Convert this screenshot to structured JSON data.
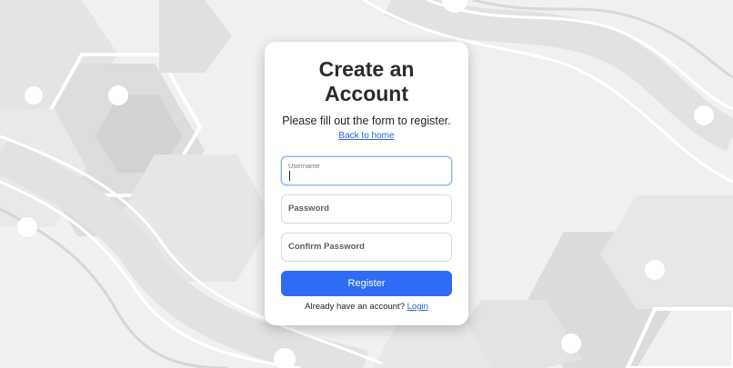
{
  "form": {
    "title": "Create an Account",
    "subtitle": "Please fill out the form to register.",
    "back_link": "Back to home",
    "username_label": "Username",
    "password_placeholder": "Password",
    "confirm_placeholder": "Confirm Password",
    "register_label": "Register",
    "login_prompt": "Already have an account?",
    "login_link": "Login"
  },
  "colors": {
    "accent": "#2f6cf4",
    "link": "#2b63d9",
    "background": "#efefef"
  }
}
